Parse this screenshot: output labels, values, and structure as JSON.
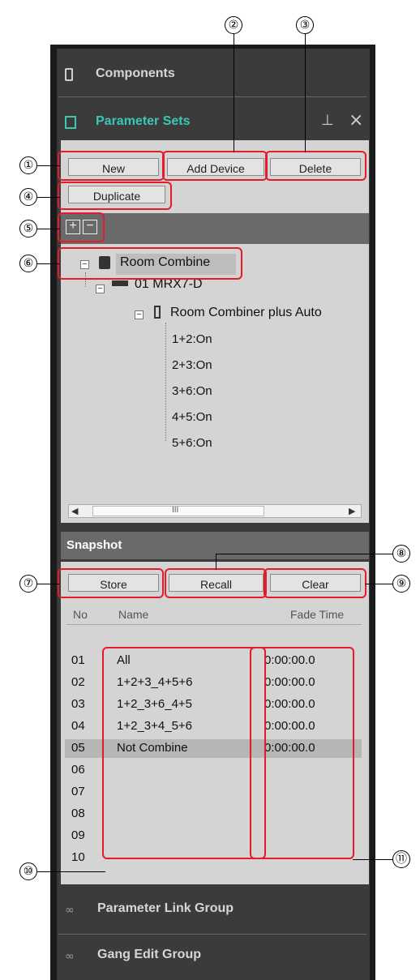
{
  "panels": {
    "components": "Components",
    "parameter_sets": "Parameter Sets",
    "parameter_link_group": "Parameter Link Group",
    "gang_edit_group": "Gang Edit Group"
  },
  "toolbar": {
    "new": "New",
    "add_device": "Add Device",
    "delete": "Delete",
    "duplicate": "Duplicate"
  },
  "tree": {
    "root": "Room Combine",
    "device": "01 MRX7-D",
    "component": "Room Combiner plus Auto",
    "sets": [
      "1+2:On",
      "2+3:On",
      "3+6:On",
      "4+5:On",
      "5+6:On"
    ]
  },
  "scrollbar": {
    "thumb_glyph": "III"
  },
  "snapshot": {
    "title": "Snapshot",
    "store": "Store",
    "recall": "Recall",
    "clear": "Clear",
    "columns": {
      "no": "No",
      "name": "Name",
      "fade": "Fade Time"
    },
    "rows": [
      {
        "no": "01",
        "name": "All",
        "fade": "0:00:00.0"
      },
      {
        "no": "02",
        "name": "1+2+3_4+5+6",
        "fade": "0:00:00.0"
      },
      {
        "no": "03",
        "name": "1+2_3+6_4+5",
        "fade": "0:00:00.0"
      },
      {
        "no": "04",
        "name": "1+2_3+4_5+6",
        "fade": "0:00:00.0"
      },
      {
        "no": "05",
        "name": "Not Combine",
        "fade": "0:00:00.0"
      },
      {
        "no": "06",
        "name": "",
        "fade": ""
      },
      {
        "no": "07",
        "name": "",
        "fade": ""
      },
      {
        "no": "08",
        "name": "",
        "fade": ""
      },
      {
        "no": "09",
        "name": "",
        "fade": ""
      },
      {
        "no": "10",
        "name": "",
        "fade": ""
      }
    ]
  },
  "callouts": [
    "①",
    "②",
    "③",
    "④",
    "⑤",
    "⑥",
    "⑦",
    "⑧",
    "⑨",
    "⑩",
    "⑪"
  ],
  "colors": {
    "annotation": "#e51a2b",
    "accent": "#3cc7b4",
    "selected_row": "#b6b6b6"
  }
}
